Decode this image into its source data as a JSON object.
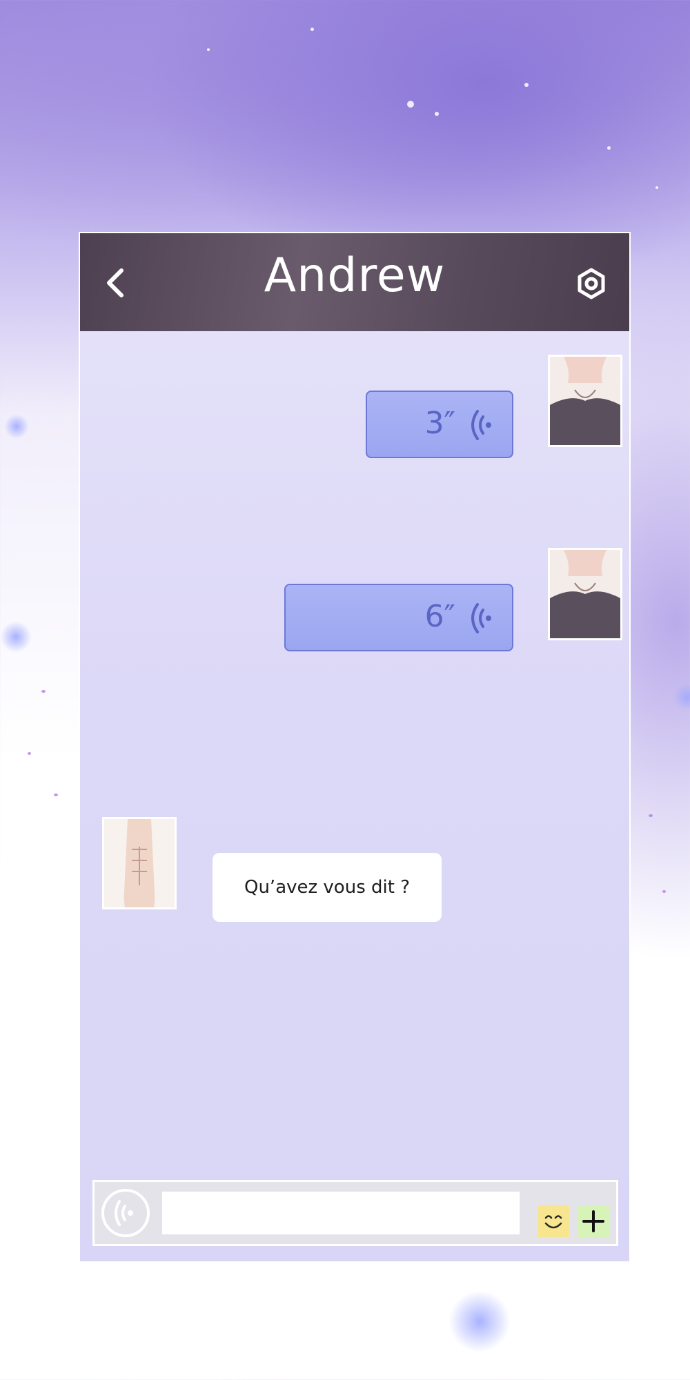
{
  "header": {
    "title": "Andrew"
  },
  "messages": [
    {
      "side": "right",
      "kind": "voice",
      "duration": "3″",
      "avatar": "avatar-user"
    },
    {
      "side": "right",
      "kind": "voice",
      "duration": "6″",
      "avatar": "avatar-user"
    },
    {
      "side": "left",
      "kind": "text",
      "text": "Qu’avez vous dit ?",
      "avatar": "avatar-contact"
    }
  ],
  "input": {
    "value": "",
    "placeholder": ""
  },
  "icons": {
    "back": "back-arrow-icon",
    "settings": "hexagon-settings-icon",
    "voice_wave": "sound-wave-icon",
    "mic": "voice-input-icon",
    "emoji": "smiley-face-icon",
    "plus": "plus-icon"
  },
  "colors": {
    "header_bg": "#574a5b",
    "voice_bubble": "#9aa6f0",
    "voice_border": "#6d78d6",
    "text_bubble": "#ffffff",
    "emoji_button": "#f7e58f",
    "plus_button": "#d7f3b8"
  }
}
